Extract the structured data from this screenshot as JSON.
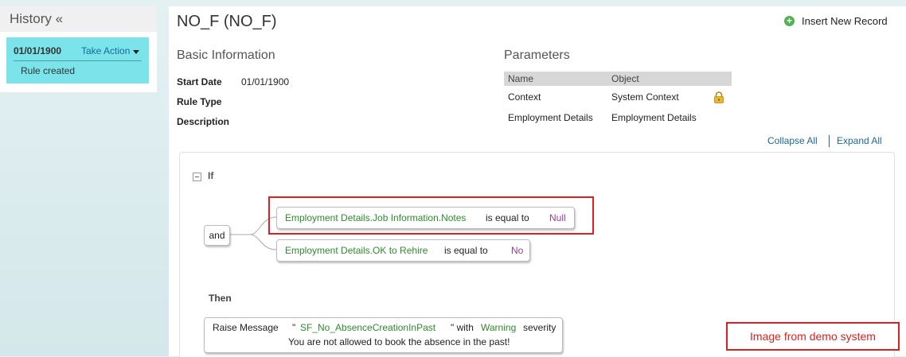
{
  "history": {
    "title": "History «",
    "entries": [
      {
        "date": "01/01/1900",
        "action_label": "Take Action",
        "description": "Rule created"
      }
    ]
  },
  "rule": {
    "title": "NO_F (NO_F)",
    "insert_label": "Insert New Record"
  },
  "basic_info": {
    "heading": "Basic Information",
    "start_date_label": "Start Date",
    "start_date_value": "01/01/1900",
    "rule_type_label": "Rule Type",
    "description_label": "Description"
  },
  "parameters": {
    "heading": "Parameters",
    "columns": [
      "Name",
      "Object"
    ],
    "rows": [
      {
        "name": "Context",
        "object": "System Context",
        "locked": true
      },
      {
        "name": "Employment Details",
        "object": "Employment Details",
        "locked": false
      }
    ]
  },
  "tree_controls": {
    "collapse_all": "Collapse All",
    "expand_all": "Expand All"
  },
  "if_block": {
    "label": "If",
    "operator": "and",
    "conditions": [
      {
        "field": "Employment Details.Job Information.Notes",
        "op": "is equal to",
        "value": "Null"
      },
      {
        "field": "Employment Details.OK to Rehire",
        "op": "is equal to",
        "value": "No"
      }
    ]
  },
  "then_block": {
    "label": "Then",
    "action": "Raise Message",
    "open_quote": "\"",
    "message_key": "SF_No_AbsenceCreationInPast",
    "close_quote": "\" with",
    "severity": "Warning",
    "severity_suffix": "severity",
    "message_text": "You are not allowed to book the absence in the past!"
  },
  "note": "Image from demo system",
  "colors": {
    "highlight": "#e02020",
    "history_entry": "#7be3ea",
    "field": "#2e8b2e",
    "value": "#9b3a9b",
    "link": "#1a6a9a"
  }
}
